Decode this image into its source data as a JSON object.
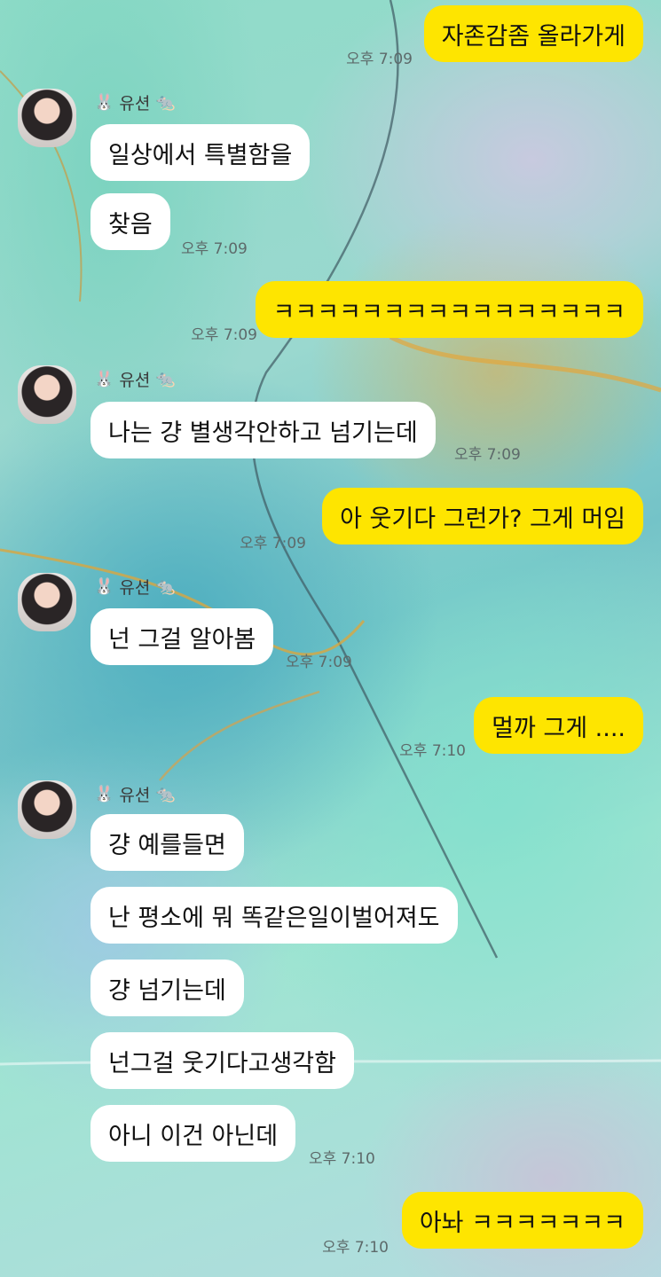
{
  "chat": {
    "sender_name": "유션",
    "sender_prefix_icon": "rabbit-emoji",
    "sender_suffix_icon": "rat-emoji",
    "colors": {
      "outgoing_bubble": "#fee500",
      "incoming_bubble": "#ffffff"
    },
    "messages": [
      {
        "text": "자존감좀 올라가게",
        "time": "오후 7:09"
      },
      {
        "text": "일상에서 특별함을"
      },
      {
        "text": "찾음",
        "time": "오후 7:09"
      },
      {
        "text": "ㅋㅋㅋㅋㅋㅋㅋㅋㅋㅋㅋㅋㅋㅋㅋㅋ",
        "time": "오후 7:09"
      },
      {
        "text": "나는 걍 별생각안하고 넘기는데",
        "time": "오후 7:09"
      },
      {
        "text": "아 웃기다 그런가? 그게 머임",
        "time": "오후 7:09"
      },
      {
        "text": "넌 그걸 알아봄",
        "time": "오후 7:09"
      },
      {
        "text": "멀까 그게 ....",
        "time": "오후 7:10"
      },
      {
        "text": "걍 예를들면"
      },
      {
        "text": "난 평소에 뭐 똑같은일이벌어져도"
      },
      {
        "text": "걍 넘기는데"
      },
      {
        "text": "넌그걸 웃기다고생각함"
      },
      {
        "text": "아니 이건 아닌데",
        "time": "오후 7:10"
      },
      {
        "text": "아놔 ㅋㅋㅋㅋㅋㅋㅋ",
        "time": "오후 7:10"
      }
    ]
  }
}
